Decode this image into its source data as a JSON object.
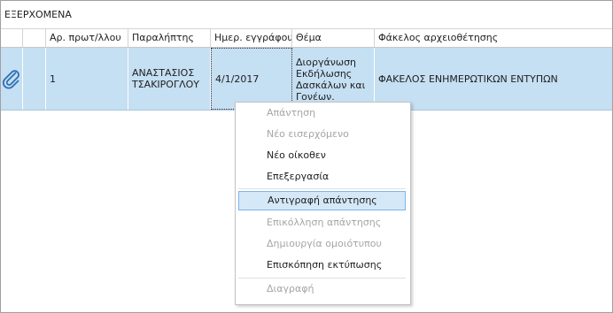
{
  "group": {
    "title": "ΕΞΕΡΧΟΜΕΝΑ"
  },
  "columns": [
    "",
    "",
    "Αρ. πρωτ/λλου",
    "Παραλήπτης",
    "Ημερ. εγγράφου",
    "Θέμα",
    "Φάκελος αρχειοθέτησης"
  ],
  "rows": [
    {
      "attachment_icon": "paperclip-icon",
      "number": "1",
      "recipient": "ΑΝΑΣΤΑΣΙΟΣ ΤΣΑΚΙΡΟΓΛΟΥ",
      "date": "4/1/2017",
      "subject": "Διοργάνωση Εκδήλωσης Δασκάλων και Γονέων.",
      "folder": "ΦΑΚΕΛΟΣ ΕΝΗΜΕΡΩΤΙΚΩΝ ΕΝΤΥΠΩΝ"
    }
  ],
  "context_menu": {
    "items": [
      {
        "label": "Απάντηση",
        "enabled": false
      },
      {
        "label": "Νέο εισερχόμενο",
        "enabled": false
      },
      {
        "label": "Νέο οίκοθεν",
        "enabled": true
      },
      {
        "label": "Επεξεργασία",
        "enabled": true
      },
      {
        "label": "Αντιγραφή απάντησης",
        "enabled": true,
        "highlighted": true
      },
      {
        "label": "Επικόλληση απάντησης",
        "enabled": false
      },
      {
        "label": "Δημιουργία ομοιότυπου",
        "enabled": false
      },
      {
        "label": "Επισκόπηση εκτύπωσης",
        "enabled": true
      },
      {
        "label": "Διαγραφή",
        "enabled": false
      }
    ]
  },
  "colors": {
    "selected_row": "#c5dff3",
    "menu_highlight": "#d5e8f8",
    "disabled_text": "#a5a5a5",
    "clip_icon": "#2f6fb3"
  }
}
